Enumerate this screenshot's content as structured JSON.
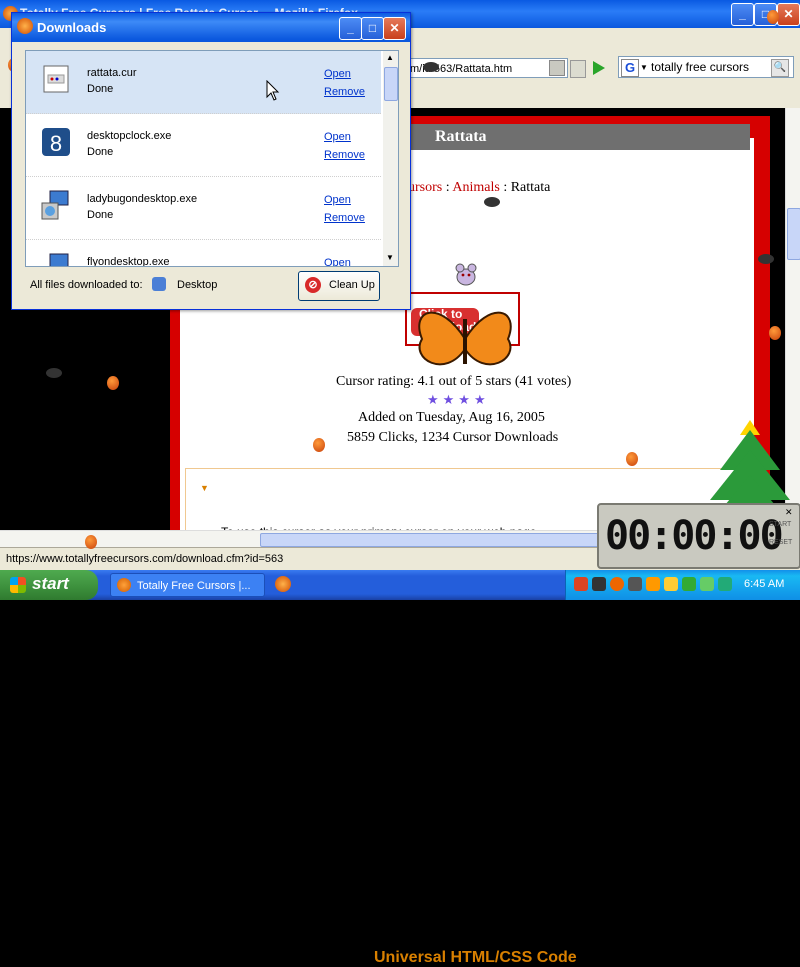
{
  "browser": {
    "title": "Totally Free Cursors | Free Rattata Cursor ... Mozilla Firefox",
    "address": "m/id/563/Rattata.htm",
    "search_value": "totally free cursors",
    "search_engine_icon": "google-icon",
    "status_url": "https://www.totallyfreecursors.com/download.cfm?id=563"
  },
  "page": {
    "header": "Rattata",
    "breadcrumb": {
      "part1": "ursors",
      "sep1": " : ",
      "part2": "Animals",
      "sep2": " : ",
      "part3": "Rattata"
    },
    "download_button": "Click to\nDownload",
    "rating": "Cursor rating: 4.1 out of 5 stars (41 votes)",
    "stars": "★★★★",
    "added": "Added on Tuesday, Aug 16, 2005",
    "clicks": "5859 Clicks, 1234 Cursor Downloads",
    "code_title": "Universal HTML/CSS Code",
    "code_text": "To use this cursor as your primary cursor on your web page..."
  },
  "downloads": {
    "title": "Downloads",
    "items": [
      {
        "name": "rattata.cur",
        "status": "Done",
        "open": "Open",
        "remove": "Remove",
        "icon": "cursor-file-icon"
      },
      {
        "name": "desktopclock.exe",
        "status": "Done",
        "open": "Open",
        "remove": "Remove",
        "icon": "clock-app-icon"
      },
      {
        "name": "ladybugondesktop.exe",
        "status": "Done",
        "open": "Open",
        "remove": "Remove",
        "icon": "installer-icon"
      },
      {
        "name": "flyondesktop.exe",
        "status": "",
        "open": "Open",
        "remove": "",
        "icon": "installer-icon"
      }
    ],
    "footer_label": "All files downloaded to:",
    "location": "Desktop",
    "cleanup": "Clean Up"
  },
  "timer": {
    "display": "00:00:00",
    "start": "START",
    "reset": "RESET"
  },
  "taskbar": {
    "start": "start",
    "task": "Totally Free Cursors |...",
    "clock": "6:45 AM"
  },
  "colors": {
    "xp_blue": "#0a5ae2",
    "accent_red": "#d60000",
    "link_blue": "#0033cc",
    "code_orange": "#d98000"
  }
}
